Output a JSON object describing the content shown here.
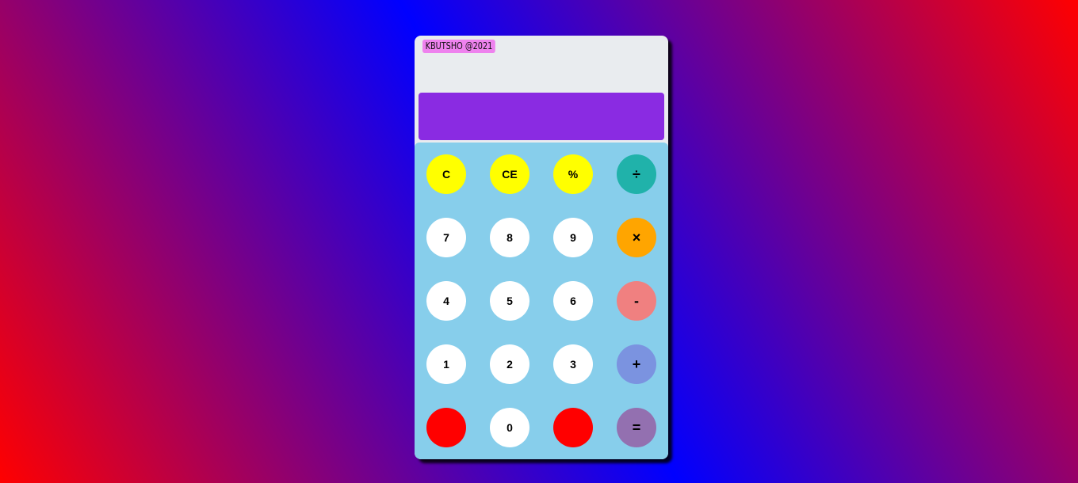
{
  "calculator": {
    "brand": "KBUTSHO @2021",
    "display_value": ""
  },
  "keys": {
    "clear": "C",
    "clear_entry": "CE",
    "percent": "%",
    "divide": "÷",
    "seven": "7",
    "eight": "8",
    "nine": "9",
    "multiply": "×",
    "four": "4",
    "five": "5",
    "six": "6",
    "subtract": "-",
    "one": "1",
    "two": "2",
    "three": "3",
    "add": "+",
    "zero": "0",
    "equals": "="
  },
  "colors": {
    "background_gradient": [
      "#ff0000",
      "#0000ff",
      "#ff0000"
    ],
    "display": "#8a2be2",
    "keypad": "#87ceeb",
    "brand_badge": "#ee82ee",
    "function_keys": "#ffff00",
    "divide": "#20b2aa",
    "multiply": "#ffa500",
    "subtract": "#f08080",
    "add": "#7b93e0",
    "equals": "#9370b0",
    "number_keys": "#ffffff",
    "blank_keys": "#ff0000"
  }
}
